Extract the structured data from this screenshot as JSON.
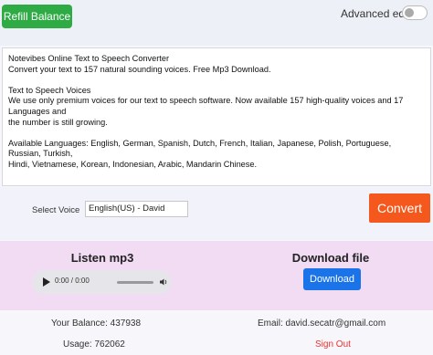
{
  "header": {
    "refill_label": "Refill Balance",
    "advanced_editor_label": "Advanced editor"
  },
  "editor": {
    "lines": [
      "Notevibes Online Text to Speech Converter",
      "Convert your text to 157 natural sounding voices. Free Mp3 Download.",
      "",
      "Text to Speech Voices",
      "We use only premium voices for our text to speech software. Now available 157 high-quality voices and 17 Languages and",
      "the number is still growing.",
      "",
      "Available Languages: English, German, Spanish, Dutch, French, Italian, Japanese, Polish, Portuguese, Russian, Turkish,",
      "Hindi, Vietnamese, Korean, Indonesian, Arabic, Mandarin Chinese."
    ]
  },
  "voice": {
    "label": "Select Voice",
    "selected": "English(US) - David",
    "convert_label": "Convert"
  },
  "media": {
    "listen_title": "Listen mp3",
    "audio_time": "0:00 / 0:00",
    "download_title": "Download file",
    "download_label": "Download"
  },
  "footer": {
    "balance": "Your Balance: 437938",
    "email": "Email: david.secatr@gmail.com",
    "usage": "Usage: 762062",
    "signout": "Sign Out"
  },
  "colors": {
    "refill_green": "#2eab44",
    "convert_orange": "#f5581c",
    "download_blue": "#1a73e8",
    "media_panel_pink": "#f2dcf4",
    "signout_red": "#e33333"
  },
  "icons": [
    "play-icon",
    "volume-icon"
  ]
}
